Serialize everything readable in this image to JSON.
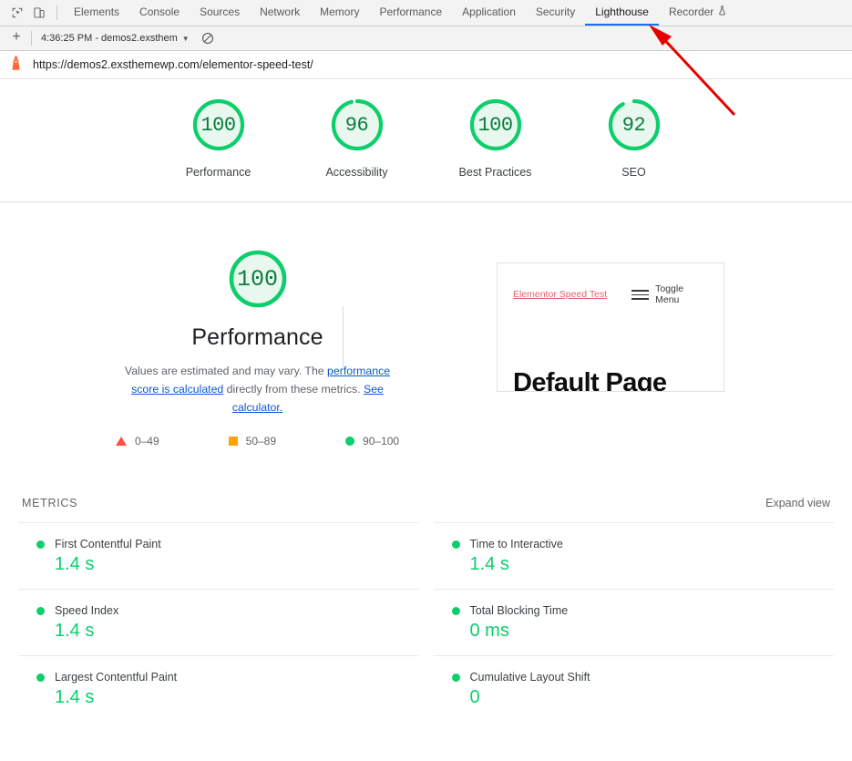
{
  "devtools": {
    "dock_icons": [
      {
        "name": "inspect-element-icon",
        "title": "Inspect element"
      },
      {
        "name": "device-toolbar-icon",
        "title": "Toggle device toolbar"
      }
    ],
    "tabs": [
      {
        "id": "elements",
        "label": "Elements",
        "active": false
      },
      {
        "id": "console",
        "label": "Console",
        "active": false
      },
      {
        "id": "sources",
        "label": "Sources",
        "active": false
      },
      {
        "id": "network",
        "label": "Network",
        "active": false
      },
      {
        "id": "memory",
        "label": "Memory",
        "active": false
      },
      {
        "id": "performance",
        "label": "Performance",
        "active": false
      },
      {
        "id": "application",
        "label": "Application",
        "active": false
      },
      {
        "id": "security",
        "label": "Security",
        "active": false
      },
      {
        "id": "lighthouse",
        "label": "Lighthouse",
        "active": true
      },
      {
        "id": "recorder",
        "label": "Recorder",
        "active": false,
        "icon": "flask-icon"
      }
    ],
    "toolbar": {
      "new_report_label": "+",
      "report_select_value": "4:36:25 PM - demos2.exsthem",
      "caret": "▼",
      "clear_icon": "clear-all-icon"
    },
    "url_bar": {
      "icon": "lighthouse-icon",
      "url": "https://demos2.exsthemewp.com/elementor-speed-test/"
    }
  },
  "report": {
    "scores": [
      {
        "id": "performance",
        "value": "100",
        "label": "Performance",
        "percent": 100
      },
      {
        "id": "accessibility",
        "value": "96",
        "label": "Accessibility",
        "percent": 96
      },
      {
        "id": "best-practices",
        "value": "100",
        "label": "Best Practices",
        "percent": 100
      },
      {
        "id": "seo",
        "value": "92",
        "label": "SEO",
        "percent": 92
      }
    ],
    "category": {
      "score_value": "100",
      "score_percent": 100,
      "title": "Performance",
      "description_part1": "Values are estimated and may vary. The ",
      "description_link1": "performance score is calculated",
      "description_part2": " directly from these metrics. ",
      "description_link2": "See calculator.",
      "legend": [
        {
          "shape": "triangle",
          "range": "0–49",
          "color": "#ff4e42"
        },
        {
          "shape": "square",
          "range": "50–89",
          "color": "#ffa400"
        },
        {
          "shape": "circle",
          "range": "90–100",
          "color": "#0cce6b"
        }
      ]
    },
    "thumbnail": {
      "brand": "Elementor Speed Test",
      "menu_label": "Toggle Menu",
      "heading": "Default Page"
    },
    "metrics": {
      "section_title": "METRICS",
      "expand_label": "Expand view",
      "left": [
        {
          "name": "First Contentful Paint",
          "value": "1.4 s",
          "status": "pass"
        },
        {
          "name": "Speed Index",
          "value": "1.4 s",
          "status": "pass"
        },
        {
          "name": "Largest Contentful Paint",
          "value": "1.4 s",
          "status": "pass"
        }
      ],
      "right": [
        {
          "name": "Time to Interactive",
          "value": "1.4 s",
          "status": "pass"
        },
        {
          "name": "Total Blocking Time",
          "value": "0 ms",
          "status": "pass"
        },
        {
          "name": "Cumulative Layout Shift",
          "value": "0",
          "status": "pass"
        }
      ]
    }
  },
  "annotation": {
    "arrow_color": "#e60000",
    "points_to": "Lighthouse"
  },
  "colors": {
    "pass": "#0cce6b",
    "pass_text": "#0b7c3e",
    "average": "#ffa400",
    "fail": "#ff4e42",
    "link": "#0b57d0",
    "accent_tab": "#1a73e8"
  }
}
